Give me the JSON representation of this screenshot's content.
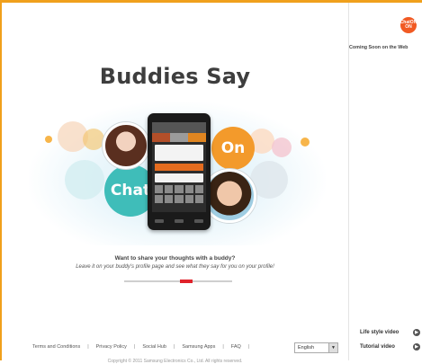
{
  "hero": {
    "title": "Buddies Say",
    "bubble_chat": "Chat",
    "bubble_on": "On",
    "question": "Want to share your thoughts with a buddy?",
    "sub": "Leave it on your buddy's profile page and see what they say for you on your profile!"
  },
  "carousel": {
    "pages": 3,
    "active_page": 2
  },
  "footer": {
    "links": [
      "Terms and Conditions",
      "Privacy Policy",
      "Social Hub",
      "Samsung Apps",
      "FAQ"
    ],
    "language": "English",
    "copyright": "Copyright © 2011 Samsung Electronics Co., Ltd. All rights reserved."
  },
  "rail": {
    "logo_line1": "ChatON",
    "logo_line2": "ON",
    "coming_soon": "Coming Soon on the Web",
    "lifestyle_video": "Life style video",
    "tutorial_video": "Tutorial video"
  },
  "colors": {
    "accent": "#f0a01c",
    "chat": "#3fbdb9",
    "on": "#f39a2b",
    "carousel_active": "#e0232b"
  }
}
